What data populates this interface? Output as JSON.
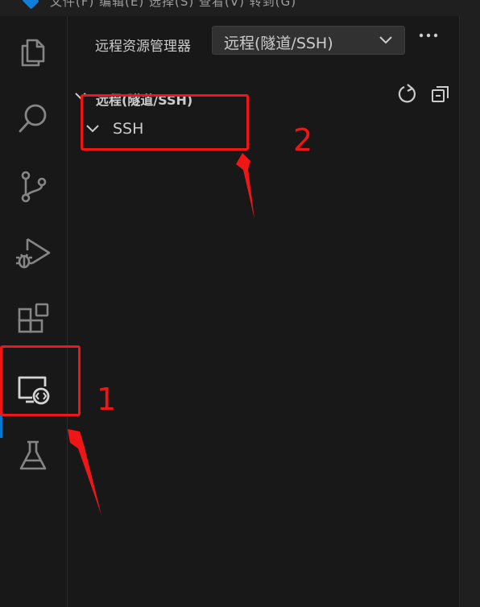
{
  "titlebar": {
    "menu_fragments": "文件(F)   编辑(E)   选择(S)   查看(V)   转到(G)"
  },
  "activity_bar": {
    "items": [
      {
        "icon": "files-icon"
      },
      {
        "icon": "search-icon"
      },
      {
        "icon": "source-control-icon"
      },
      {
        "icon": "run-debug-icon"
      },
      {
        "icon": "extensions-icon"
      },
      {
        "icon": "remote-explorer-icon",
        "active": true
      },
      {
        "icon": "testing-icon"
      }
    ]
  },
  "sidebar": {
    "title": "远程资源管理器",
    "selector": {
      "selected": "远程(隧道/SSH)"
    },
    "section": {
      "label": "远程(隧道/SSH)",
      "actions": {
        "refresh": "refresh-icon",
        "collapse_all": "collapse-all-icon"
      }
    },
    "tree": [
      {
        "label": "SSH",
        "expanded": true
      }
    ]
  },
  "annotations": {
    "label_1": "1",
    "label_2": "2",
    "color": "#f01616"
  },
  "theme": {
    "background": "#181818",
    "accent": "#0078d4",
    "icon": "#858585",
    "text": "#cccccc"
  }
}
